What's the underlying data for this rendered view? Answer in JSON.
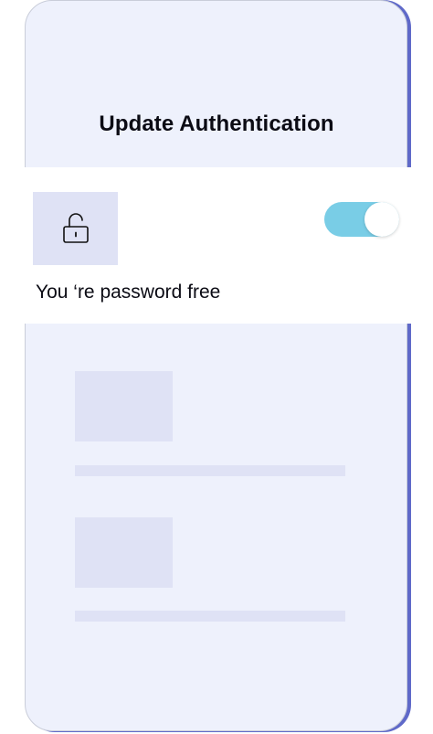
{
  "header": {
    "title": "Update Authentication"
  },
  "auth_card": {
    "icon": "unlocked-padlock-icon",
    "toggle": {
      "state": "on",
      "color": "#79cde6"
    },
    "status_text": "You ‘re password free"
  },
  "colors": {
    "phone_background": "#eef1fc",
    "accent_edge": "#5f69c9",
    "placeholder": "#dfe2f5",
    "toggle_on": "#79cde6"
  }
}
